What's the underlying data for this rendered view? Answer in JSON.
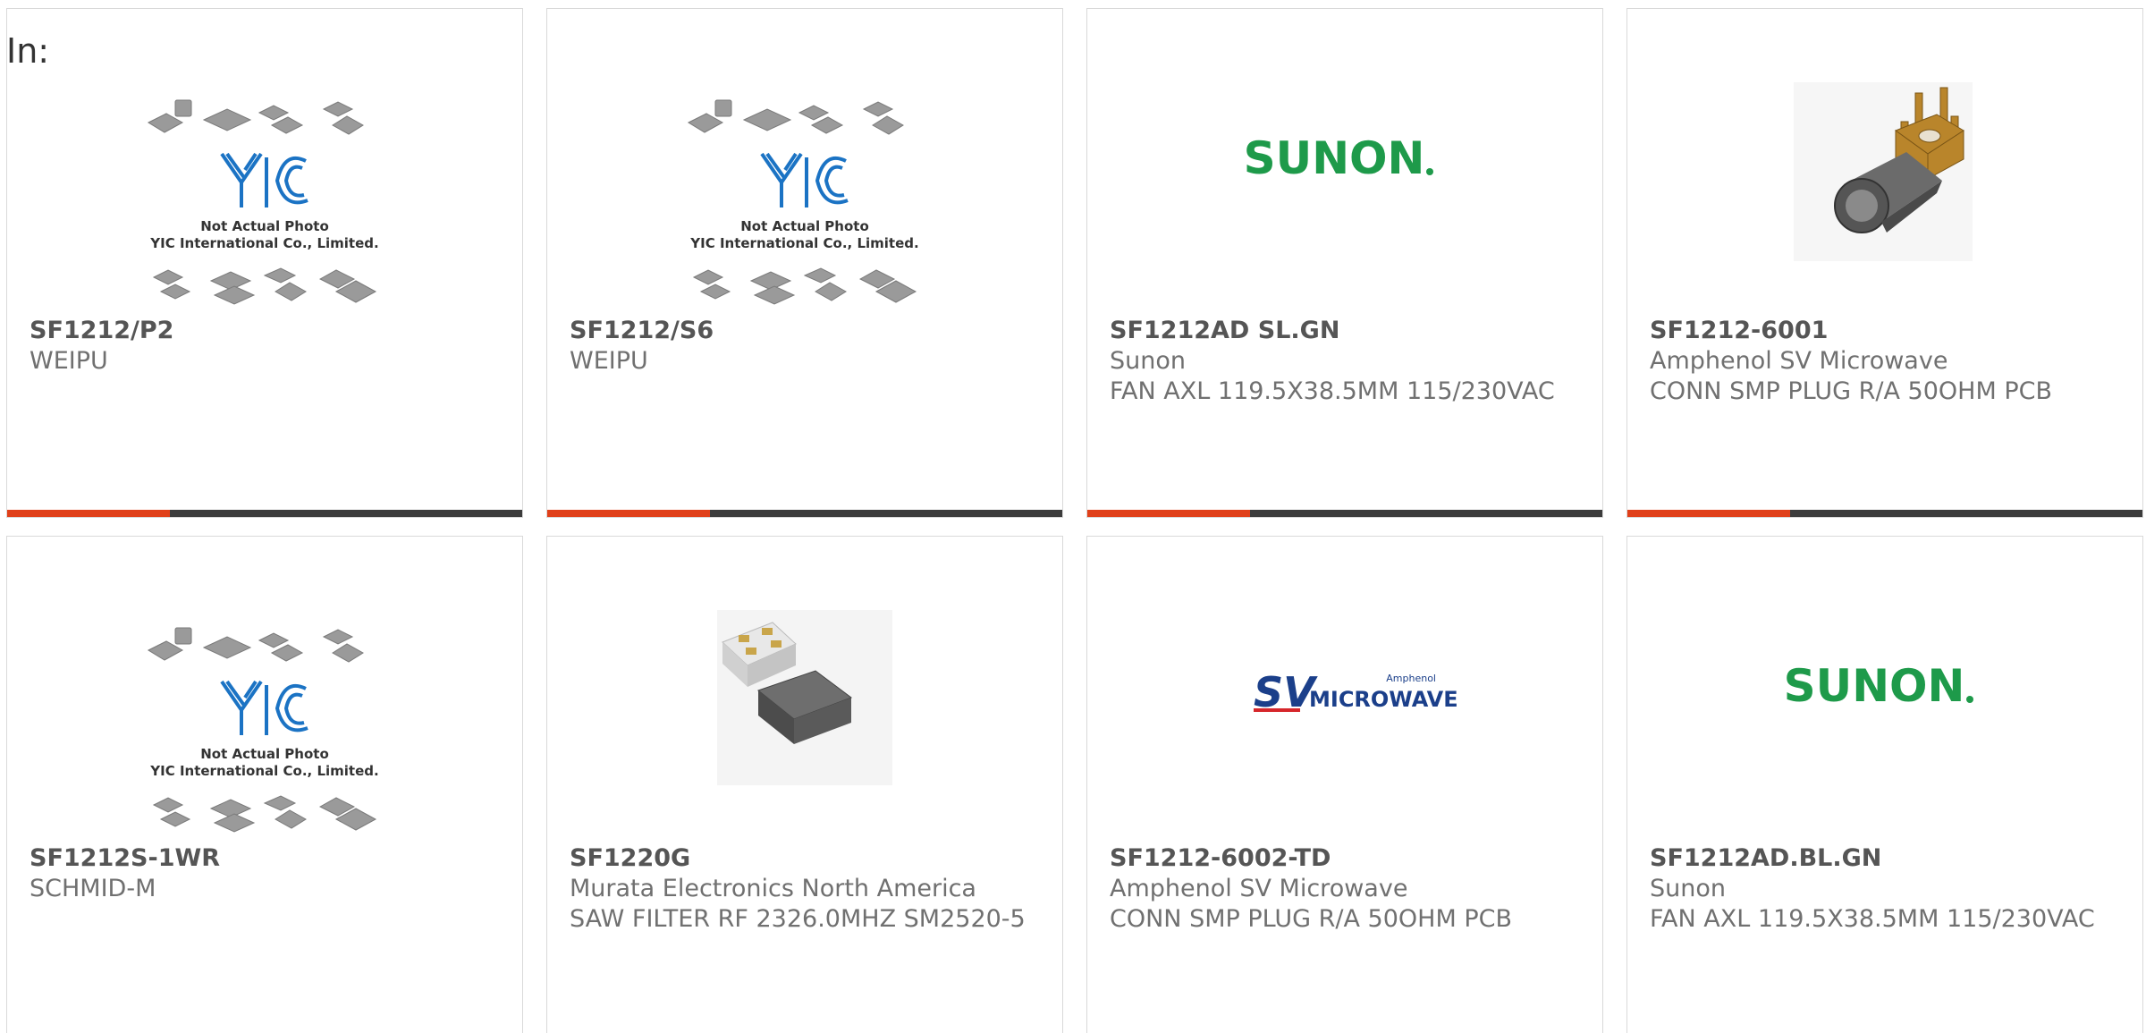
{
  "filter_label": "In:",
  "placeholder": {
    "line1": "Not Actual Photo",
    "line2": "YIC International Co., Limited.",
    "logo": "YIC"
  },
  "logos": {
    "sunon": "SUNON",
    "sv_small": "Amphenol",
    "sv_big": "MICROWAVE",
    "sv_brand": "SV"
  },
  "colors": {
    "accent_bar": "#e0401a",
    "dark_bar": "#3c3c3c",
    "sunon_green": "#1e9a4a",
    "yic_blue": "#1b73c4"
  },
  "products": [
    {
      "part_number": "SF1212/P2",
      "manufacturer": "WEIPU",
      "description": "",
      "image": "yic-placeholder"
    },
    {
      "part_number": "SF1212/S6",
      "manufacturer": "WEIPU",
      "description": "",
      "image": "yic-placeholder"
    },
    {
      "part_number": "SF1212AD SL.GN",
      "manufacturer": "Sunon",
      "description": "FAN AXL 119.5X38.5MM 115/230VAC",
      "image": "sunon-logo"
    },
    {
      "part_number": "SF1212-6001",
      "manufacturer": "Amphenol SV Microwave",
      "description": "CONN SMP PLUG R/A 50OHM PCB",
      "image": "rf-connector-photo"
    },
    {
      "part_number": "SF1212S-1WR",
      "manufacturer": "SCHMID-M",
      "description": "",
      "image": "yic-placeholder"
    },
    {
      "part_number": "SF1220G",
      "manufacturer": "Murata Electronics North America",
      "description": "SAW FILTER RF 2326.0MHZ SM2520-5",
      "image": "saw-filter-photo"
    },
    {
      "part_number": "SF1212-6002-TD",
      "manufacturer": "Amphenol SV Microwave",
      "description": "CONN SMP PLUG R/A 50OHM PCB",
      "image": "sv-microwave-logo"
    },
    {
      "part_number": "SF1212AD.BL.GN",
      "manufacturer": "Sunon",
      "description": "FAN AXL 119.5X38.5MM 115/230VAC",
      "image": "sunon-logo"
    }
  ]
}
